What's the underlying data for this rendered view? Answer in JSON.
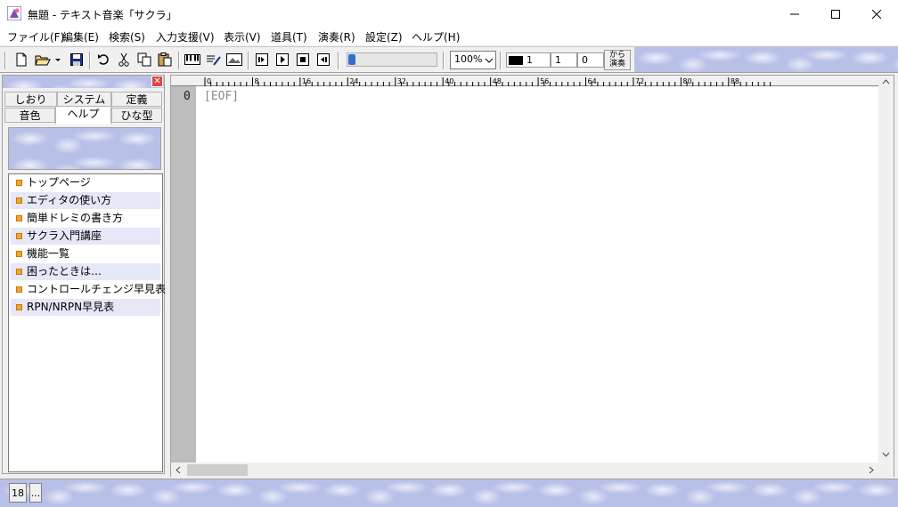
{
  "window": {
    "title": "無題 - テキスト音楽「サクラ」",
    "icons": {
      "app": "sakura-app-icon",
      "minimize": "minimize-icon",
      "maximize": "maximize-icon",
      "close": "close-icon"
    }
  },
  "menu": [
    {
      "label": "ファイル(F)"
    },
    {
      "label": "編集(E)"
    },
    {
      "label": "検索(S)"
    },
    {
      "label": "入力支援(V)"
    },
    {
      "label": "表示(V)"
    },
    {
      "label": "道具(T)"
    },
    {
      "label": "演奏(R)"
    },
    {
      "label": "設定(Z)"
    },
    {
      "label": "ヘルプ(H)"
    }
  ],
  "toolbar": {
    "zoom": "100%",
    "field1": "1",
    "field2": "1",
    "field3": "0",
    "play_from": "から\n演奏",
    "progress_percent": 0
  },
  "side_panel": {
    "tabs_row1": [
      "しおり",
      "システム",
      "定義"
    ],
    "tabs_row2": [
      "音色",
      "ヘルプ",
      "ひな型"
    ],
    "active_tab": "ヘルプ",
    "help_items": [
      "トップページ",
      "エディタの使い方",
      "簡単ドレミの書き方",
      "サクラ入門講座",
      "機能一覧",
      "困ったときは…",
      "コントロールチェンジ早見表",
      "RPN/NRPN早見表"
    ]
  },
  "editor": {
    "ruler_labels": [
      "0",
      "8",
      "16",
      "24",
      "32",
      "40",
      "48",
      "56",
      "64",
      "72",
      "80",
      "88"
    ],
    "line_number": "0",
    "content": "[EOF]"
  },
  "status": {
    "line": "18",
    "dots": "..."
  }
}
